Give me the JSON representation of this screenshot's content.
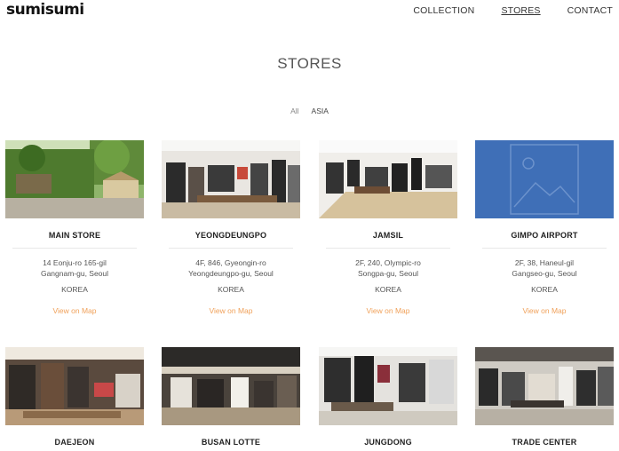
{
  "header": {
    "logo": "sumisumi",
    "nav": [
      {
        "label": "COLLECTION",
        "active": false
      },
      {
        "label": "STORES",
        "active": true
      },
      {
        "label": "CONTACT",
        "active": false
      }
    ]
  },
  "page": {
    "title": "STORES",
    "filters": [
      "All",
      "ASIA"
    ]
  },
  "stores": [
    {
      "name": "MAIN STORE",
      "address_line1": "14 Eonju-ro 165-gil",
      "address_line2": "Gangnam-gu, Seoul",
      "country": "KOREA",
      "map_link": "View on Map",
      "image": "garden"
    },
    {
      "name": "YEONGDEUNGPO",
      "address_line1": "4F, 846, Gyeongin-ro",
      "address_line2": "Yeongdeungpo-gu, Seoul",
      "country": "KOREA",
      "map_link": "View on Map",
      "image": "store-bright"
    },
    {
      "name": "JAMSIL",
      "address_line1": "2F, 240, Olympic-ro",
      "address_line2": "Songpa-gu, Seoul",
      "country": "KOREA",
      "map_link": "View on Map",
      "image": "store-bright"
    },
    {
      "name": "GIMPO AIRPORT",
      "address_line1": "2F, 38, Haneul-gil",
      "address_line2": "Gangseo-gu, Seoul",
      "country": "KOREA",
      "map_link": "View on Map",
      "image": "placeholder"
    },
    {
      "name": "DAEJEON",
      "image": "store-warm"
    },
    {
      "name": "BUSAN LOTTE",
      "image": "store-dark"
    },
    {
      "name": "JUNGDONG",
      "image": "store-bright"
    },
    {
      "name": "TRADE CENTER",
      "image": "store-grey"
    }
  ],
  "colors": {
    "link": "#f0a15a",
    "placeholder_bg": "#3f6fb7"
  }
}
